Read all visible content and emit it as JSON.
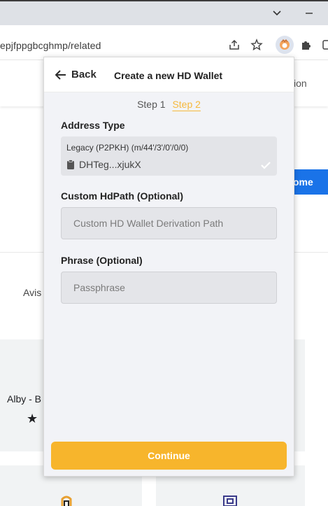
{
  "browser": {
    "url": "epjfppgbcghmp/related"
  },
  "background_page": {
    "nav_partial": "ion",
    "button_partial": "ome",
    "text_avis": "Avis",
    "text_alby": "Alby - B",
    "star_glyph": "★"
  },
  "popup": {
    "back_label": "Back",
    "title": "Create a new HD Wallet",
    "step1_label": "Step 1",
    "step2_label": "Step 2",
    "address_type": {
      "label": "Address Type",
      "type_text": "Legacy (P2PKH) (m/44'/3'/0'/0/0)",
      "address_text": "DHTeg...xjukX"
    },
    "custom_hdpath": {
      "label": "Custom HdPath (Optional)",
      "placeholder": "Custom HD Wallet Derivation Path"
    },
    "phrase": {
      "label": "Phrase (Optional)",
      "placeholder": "Passphrase"
    },
    "continue_label": "Continue"
  },
  "colors": {
    "accent": "#f7b52c",
    "step_active": "#f6b93b",
    "popup_bg": "#f2f3f7",
    "bg_button": "#1a73e8"
  }
}
